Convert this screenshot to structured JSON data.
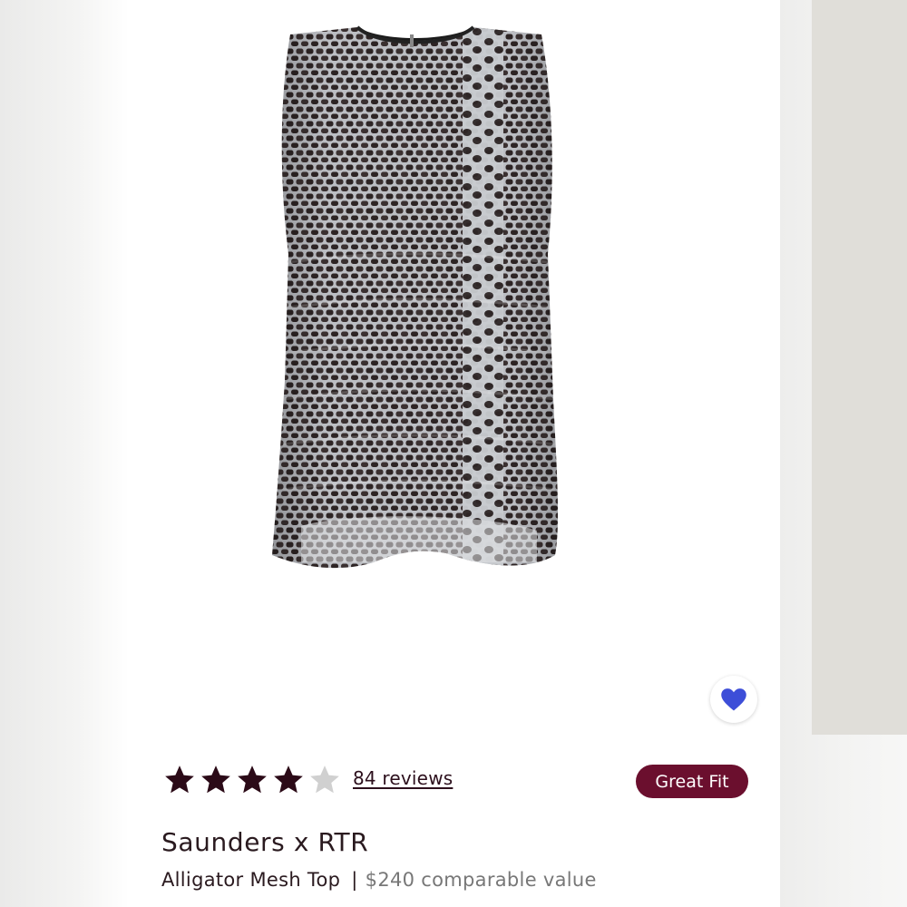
{
  "product": {
    "rating": 4,
    "max_rating": 5,
    "reviews_label": "84 reviews",
    "fit_badge": "Great Fit",
    "designer": "Saunders x RTR",
    "name": "Alligator Mesh Top",
    "separator": "|",
    "price": "$240 comparable value"
  },
  "icons": {
    "favorite": "heart-icon",
    "star_filled": "star-filled-icon",
    "star_empty": "star-empty-icon"
  },
  "colors": {
    "accent": "#6b0f2e",
    "heart": "#3d4ed8",
    "star_filled": "#2b0a17",
    "star_empty": "#d0d0d0",
    "text": "#2a1a1f"
  }
}
